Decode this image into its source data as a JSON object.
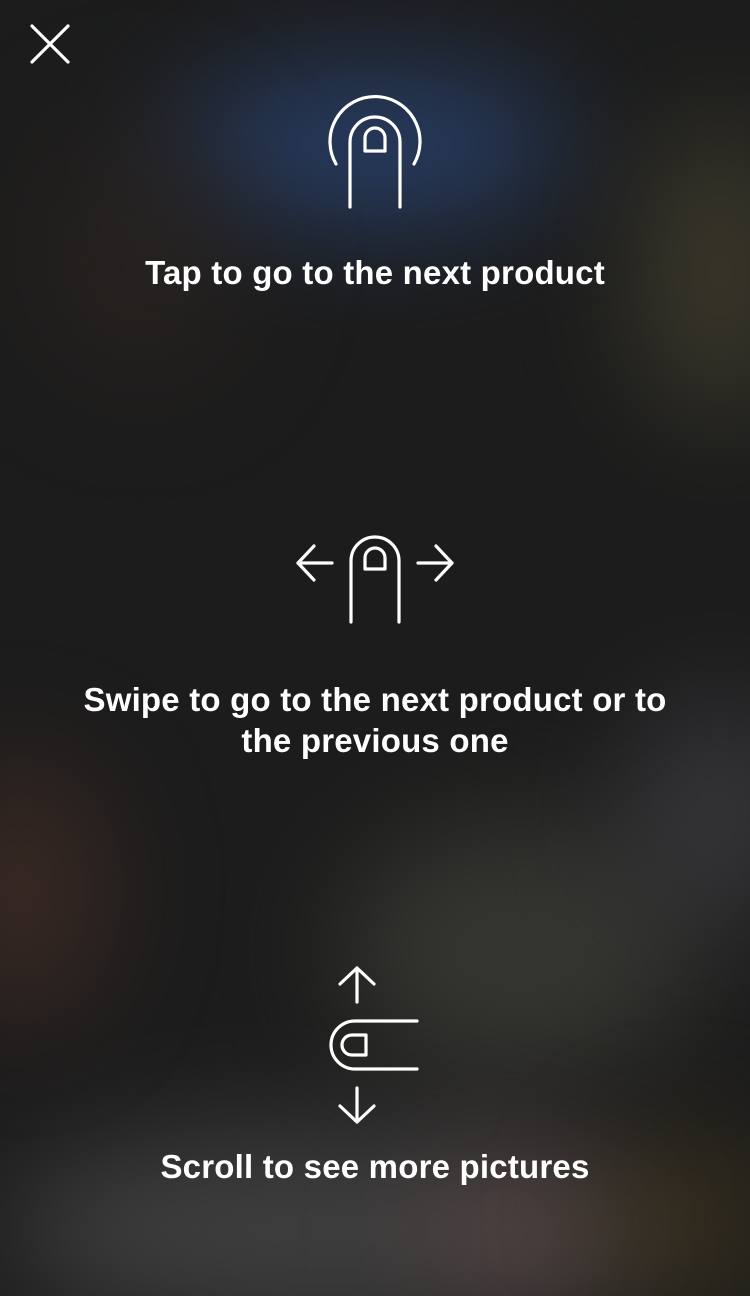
{
  "close": {
    "icon": "close-icon"
  },
  "hints": [
    {
      "icon": "tap-gesture-icon",
      "text": "Tap to go to the next product"
    },
    {
      "icon": "swipe-horizontal-gesture-icon",
      "text": "Swipe to go to the next product or to the previous one"
    },
    {
      "icon": "scroll-vertical-gesture-icon",
      "text": "Scroll to see more pictures"
    }
  ]
}
